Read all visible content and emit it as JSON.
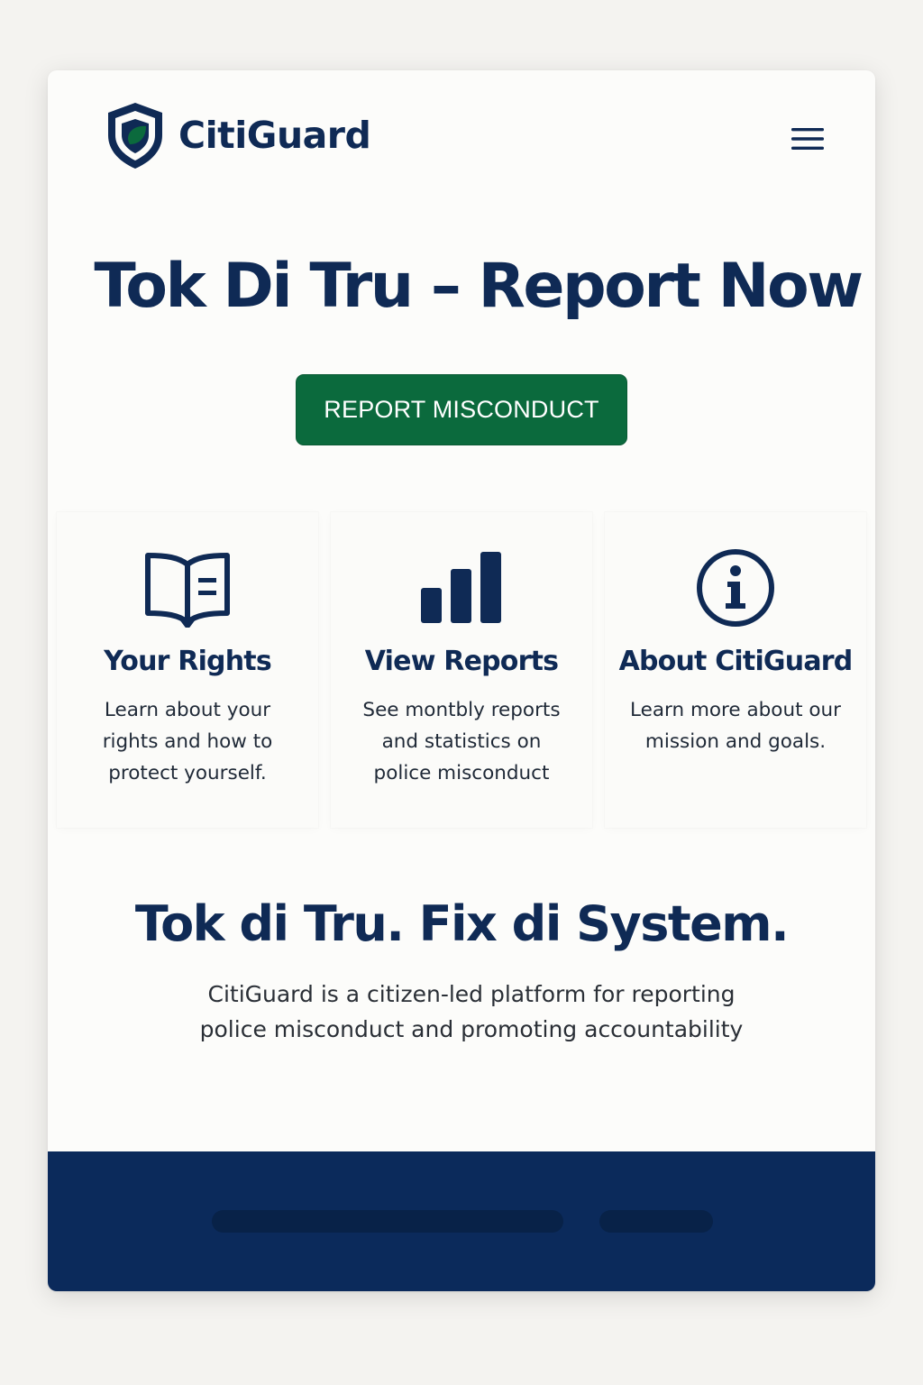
{
  "header": {
    "brand": "CitiGuard",
    "logo_icon": "shield-icon",
    "menu_icon": "hamburger-menu-icon"
  },
  "hero": {
    "title": "Tok Di Tru – Report Now",
    "cta_label": "REPORT MISCONDUCT"
  },
  "features": [
    {
      "icon": "open-book-icon",
      "title": "Your Rights",
      "desc_lines": [
        "Learn about your",
        "rights and how to",
        "protect yourself."
      ]
    },
    {
      "icon": "bar-chart-icon",
      "title": "View Reports",
      "desc_lines": [
        "See montbly reports",
        "and statistics on",
        "police misconduct"
      ]
    },
    {
      "icon": "info-icon",
      "title": "About CitiGuard",
      "desc_lines": [
        "Learn more about our",
        "mission and goals."
      ]
    }
  ],
  "about": {
    "tagline": "Tok di Tru. Fix di System.",
    "desc_lines": [
      "CitiGuard is a citizen-led platform for reporting",
      "police misconduct and promoting accountability"
    ]
  },
  "colors": {
    "primary": "#0f2a55",
    "accent_green": "#0b6a3d",
    "footer": "#0b2a5b",
    "background": "#fcfcfa"
  }
}
